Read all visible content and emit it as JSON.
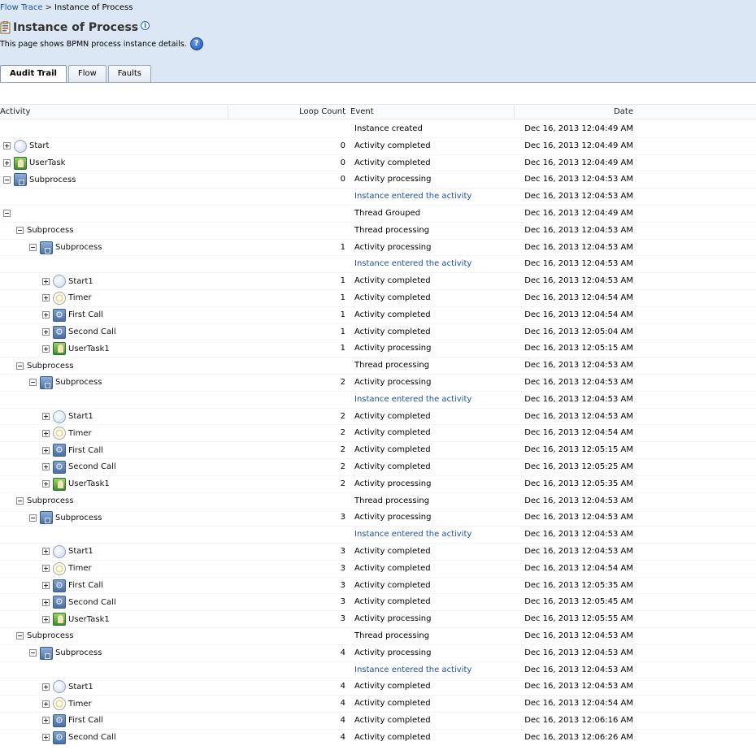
{
  "breadcrumb": {
    "link": "Flow Trace",
    "separator": ">",
    "current": "Instance of Process"
  },
  "page": {
    "title": "Instance of Process",
    "description": "This page shows BPMN process instance details."
  },
  "tabs": [
    {
      "label": "Audit Trail",
      "active": true
    },
    {
      "label": "Flow",
      "active": false
    },
    {
      "label": "Faults",
      "active": false
    }
  ],
  "columns": {
    "activity": "Activity",
    "loop_count": "Loop Count",
    "event": "Event",
    "date": "Date"
  },
  "rows": [
    {
      "level": 0,
      "expander": "",
      "icon": "",
      "activity": "",
      "loop": "",
      "event": "Instance created",
      "event_link": false,
      "date": "Dec 16, 2013 12:04:49 AM"
    },
    {
      "level": 0,
      "expander": "plus",
      "icon": "start",
      "activity": "Start",
      "loop": "0",
      "event": "Activity completed",
      "event_link": false,
      "date": "Dec 16, 2013 12:04:49 AM"
    },
    {
      "level": 0,
      "expander": "plus",
      "icon": "usertask",
      "activity": "UserTask",
      "loop": "0",
      "event": "Activity completed",
      "event_link": false,
      "date": "Dec 16, 2013 12:04:49 AM"
    },
    {
      "level": 0,
      "expander": "minus",
      "icon": "subproc",
      "activity": "Subprocess",
      "loop": "0",
      "event": "Activity processing",
      "event_link": false,
      "date": "Dec 16, 2013 12:04:53 AM"
    },
    {
      "level": 0,
      "expander": "",
      "icon": "",
      "activity": "",
      "loop": "",
      "event": "Instance entered the activity",
      "event_link": true,
      "date": "Dec 16, 2013 12:04:53 AM"
    },
    {
      "level": 0,
      "expander": "minus",
      "icon": "",
      "activity": "",
      "loop": "",
      "event": "Thread Grouped",
      "event_link": false,
      "date": "Dec 16, 2013 12:04:49 AM"
    },
    {
      "level": 1,
      "expander": "minus",
      "icon": "",
      "activity": "Subprocess",
      "loop": "",
      "event": "Thread processing",
      "event_link": false,
      "date": "Dec 16, 2013 12:04:53 AM"
    },
    {
      "level": 2,
      "expander": "minus",
      "icon": "subproc",
      "activity": "Subprocess",
      "loop": "1",
      "event": "Activity processing",
      "event_link": false,
      "date": "Dec 16, 2013 12:04:53 AM"
    },
    {
      "level": 2,
      "expander": "",
      "icon": "",
      "activity": "",
      "loop": "",
      "event": "Instance entered the activity",
      "event_link": true,
      "date": "Dec 16, 2013 12:04:53 AM"
    },
    {
      "level": 3,
      "expander": "plus",
      "icon": "start",
      "activity": "Start1",
      "loop": "1",
      "event": "Activity completed",
      "event_link": false,
      "date": "Dec 16, 2013 12:04:53 AM"
    },
    {
      "level": 3,
      "expander": "plus",
      "icon": "timer",
      "activity": "Timer",
      "loop": "1",
      "event": "Activity completed",
      "event_link": false,
      "date": "Dec 16, 2013 12:04:54 AM"
    },
    {
      "level": 3,
      "expander": "plus",
      "icon": "service",
      "activity": "First Call",
      "loop": "1",
      "event": "Activity completed",
      "event_link": false,
      "date": "Dec 16, 2013 12:04:54 AM"
    },
    {
      "level": 3,
      "expander": "plus",
      "icon": "service",
      "activity": "Second Call",
      "loop": "1",
      "event": "Activity completed",
      "event_link": false,
      "date": "Dec 16, 2013 12:05:04 AM"
    },
    {
      "level": 3,
      "expander": "plus",
      "icon": "usertask2",
      "activity": "UserTask1",
      "loop": "1",
      "event": "Activity processing",
      "event_link": false,
      "date": "Dec 16, 2013 12:05:15 AM"
    },
    {
      "level": 1,
      "expander": "minus",
      "icon": "",
      "activity": "Subprocess",
      "loop": "",
      "event": "Thread processing",
      "event_link": false,
      "date": "Dec 16, 2013 12:04:53 AM"
    },
    {
      "level": 2,
      "expander": "minus",
      "icon": "subproc",
      "activity": "Subprocess",
      "loop": "2",
      "event": "Activity processing",
      "event_link": false,
      "date": "Dec 16, 2013 12:04:53 AM"
    },
    {
      "level": 2,
      "expander": "",
      "icon": "",
      "activity": "",
      "loop": "",
      "event": "Instance entered the activity",
      "event_link": true,
      "date": "Dec 16, 2013 12:04:53 AM"
    },
    {
      "level": 3,
      "expander": "plus",
      "icon": "start",
      "activity": "Start1",
      "loop": "2",
      "event": "Activity completed",
      "event_link": false,
      "date": "Dec 16, 2013 12:04:53 AM"
    },
    {
      "level": 3,
      "expander": "plus",
      "icon": "timer",
      "activity": "Timer",
      "loop": "2",
      "event": "Activity completed",
      "event_link": false,
      "date": "Dec 16, 2013 12:04:54 AM"
    },
    {
      "level": 3,
      "expander": "plus",
      "icon": "service",
      "activity": "First Call",
      "loop": "2",
      "event": "Activity completed",
      "event_link": false,
      "date": "Dec 16, 2013 12:05:15 AM"
    },
    {
      "level": 3,
      "expander": "plus",
      "icon": "service",
      "activity": "Second Call",
      "loop": "2",
      "event": "Activity completed",
      "event_link": false,
      "date": "Dec 16, 2013 12:05:25 AM"
    },
    {
      "level": 3,
      "expander": "plus",
      "icon": "usertask2",
      "activity": "UserTask1",
      "loop": "2",
      "event": "Activity processing",
      "event_link": false,
      "date": "Dec 16, 2013 12:05:35 AM"
    },
    {
      "level": 1,
      "expander": "minus",
      "icon": "",
      "activity": "Subprocess",
      "loop": "",
      "event": "Thread processing",
      "event_link": false,
      "date": "Dec 16, 2013 12:04:53 AM"
    },
    {
      "level": 2,
      "expander": "minus",
      "icon": "subproc",
      "activity": "Subprocess",
      "loop": "3",
      "event": "Activity processing",
      "event_link": false,
      "date": "Dec 16, 2013 12:04:53 AM"
    },
    {
      "level": 2,
      "expander": "",
      "icon": "",
      "activity": "",
      "loop": "",
      "event": "Instance entered the activity",
      "event_link": true,
      "date": "Dec 16, 2013 12:04:53 AM"
    },
    {
      "level": 3,
      "expander": "plus",
      "icon": "start",
      "activity": "Start1",
      "loop": "3",
      "event": "Activity completed",
      "event_link": false,
      "date": "Dec 16, 2013 12:04:53 AM"
    },
    {
      "level": 3,
      "expander": "plus",
      "icon": "timer",
      "activity": "Timer",
      "loop": "3",
      "event": "Activity completed",
      "event_link": false,
      "date": "Dec 16, 2013 12:04:54 AM"
    },
    {
      "level": 3,
      "expander": "plus",
      "icon": "service",
      "activity": "First Call",
      "loop": "3",
      "event": "Activity completed",
      "event_link": false,
      "date": "Dec 16, 2013 12:05:35 AM"
    },
    {
      "level": 3,
      "expander": "plus",
      "icon": "service",
      "activity": "Second Call",
      "loop": "3",
      "event": "Activity completed",
      "event_link": false,
      "date": "Dec 16, 2013 12:05:45 AM"
    },
    {
      "level": 3,
      "expander": "plus",
      "icon": "usertask2",
      "activity": "UserTask1",
      "loop": "3",
      "event": "Activity processing",
      "event_link": false,
      "date": "Dec 16, 2013 12:05:55 AM"
    },
    {
      "level": 1,
      "expander": "minus",
      "icon": "",
      "activity": "Subprocess",
      "loop": "",
      "event": "Thread processing",
      "event_link": false,
      "date": "Dec 16, 2013 12:04:53 AM"
    },
    {
      "level": 2,
      "expander": "minus",
      "icon": "subproc",
      "activity": "Subprocess",
      "loop": "4",
      "event": "Activity processing",
      "event_link": false,
      "date": "Dec 16, 2013 12:04:53 AM"
    },
    {
      "level": 2,
      "expander": "",
      "icon": "",
      "activity": "",
      "loop": "",
      "event": "Instance entered the activity",
      "event_link": true,
      "date": "Dec 16, 2013 12:04:53 AM"
    },
    {
      "level": 3,
      "expander": "plus",
      "icon": "start",
      "activity": "Start1",
      "loop": "4",
      "event": "Activity completed",
      "event_link": false,
      "date": "Dec 16, 2013 12:04:53 AM"
    },
    {
      "level": 3,
      "expander": "plus",
      "icon": "timer",
      "activity": "Timer",
      "loop": "4",
      "event": "Activity completed",
      "event_link": false,
      "date": "Dec 16, 2013 12:04:54 AM"
    },
    {
      "level": 3,
      "expander": "plus",
      "icon": "service",
      "activity": "First Call",
      "loop": "4",
      "event": "Activity completed",
      "event_link": false,
      "date": "Dec 16, 2013 12:06:16 AM"
    },
    {
      "level": 3,
      "expander": "plus",
      "icon": "service",
      "activity": "Second Call",
      "loop": "4",
      "event": "Activity completed",
      "event_link": false,
      "date": "Dec 16, 2013 12:06:26 AM"
    }
  ]
}
